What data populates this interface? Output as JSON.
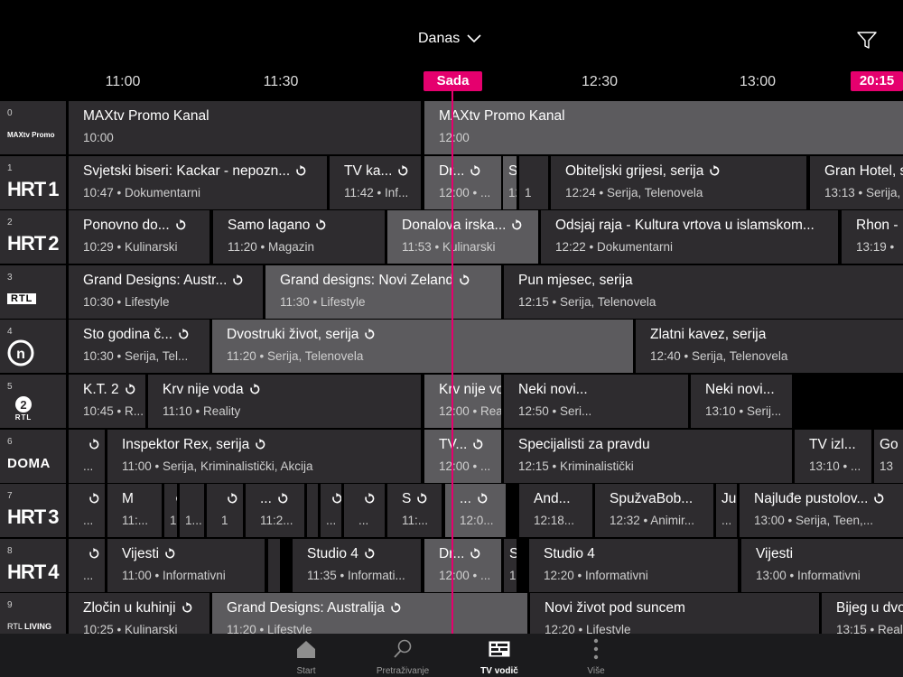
{
  "header": {
    "day": "Danas",
    "ticks": [
      "11:00",
      "11:30",
      "12:30",
      "13:00"
    ],
    "now_label": "Sada",
    "current_time": "20:15"
  },
  "channels": [
    {
      "num": "0",
      "logo": "MAXtv Promo",
      "programs": [
        {
          "title": "MAXtv Promo Kanal",
          "sub": "10:00"
        },
        {
          "title": "MAXtv Promo Kanal",
          "sub": "12:00"
        }
      ]
    },
    {
      "num": "1",
      "logo": "HRT 1",
      "programs": [
        {
          "title": "Svjetski biseri: Kackar - nepozn...",
          "sub": "10:47 • Dokumentarni"
        },
        {
          "title": "TV ka...",
          "sub": "11:42 • Inf..."
        },
        {
          "title": "Dr...",
          "sub": "12:00 • ..."
        },
        {
          "title": "S",
          "sub": "12"
        },
        {
          "title": "",
          "sub": "1"
        },
        {
          "title": "Obiteljski grijesi, serija",
          "sub": "12:24 • Serija, Telenovela"
        },
        {
          "title": "Gran Hotel, s",
          "sub": "13:13 • Serija,"
        }
      ]
    },
    {
      "num": "2",
      "logo": "HRT 2",
      "programs": [
        {
          "title": "Ponovno do...",
          "sub": "10:29 • Kulinarski"
        },
        {
          "title": "Samo lagano",
          "sub": "11:20 • Magazin"
        },
        {
          "title": "Donalova irska...",
          "sub": "11:53 • Kulinarski"
        },
        {
          "title": "Odsjaj raja - Kultura vrtova u islamskom...",
          "sub": "12:22 • Dokumentarni"
        },
        {
          "title": "Rhon -",
          "sub": "13:19 •"
        }
      ]
    },
    {
      "num": "3",
      "logo": "RTL",
      "programs": [
        {
          "title": "Grand Designs: Austr...",
          "sub": "10:30 • Lifestyle"
        },
        {
          "title": "Grand designs: Novi Zeland",
          "sub": "11:30 • Lifestyle"
        },
        {
          "title": "Pun mjesec, serija",
          "sub": "12:15 • Serija, Telenovela"
        }
      ]
    },
    {
      "num": "4",
      "logo": "Nova",
      "programs": [
        {
          "title": "Sto godina č...",
          "sub": "10:30 • Serija, Tel..."
        },
        {
          "title": "Dvostruki život, serija",
          "sub": "11:20 • Serija, Telenovela"
        },
        {
          "title": "Zlatni kavez, serija",
          "sub": "12:40 • Serija, Telenovela"
        }
      ]
    },
    {
      "num": "5",
      "logo": "RTL 2",
      "programs": [
        {
          "title": "K.T. 2",
          "sub": "10:45 • R..."
        },
        {
          "title": "Krv nije voda",
          "sub": "11:10 • Reality"
        },
        {
          "title": "Krv nije voda",
          "sub": "12:00 • Reality"
        },
        {
          "title": "Neki novi...",
          "sub": "12:50 • Seri..."
        },
        {
          "title": "Neki novi...",
          "sub": "13:10 • Serij..."
        }
      ]
    },
    {
      "num": "6",
      "logo": "DOMA",
      "programs": [
        {
          "title": "",
          "sub": "..."
        },
        {
          "title": "Inspektor Rex, serija",
          "sub": "11:00 • Serija, Kriminalistički, Akcija"
        },
        {
          "title": "TV...",
          "sub": "12:00 • ..."
        },
        {
          "title": "Specijalisti za pravdu",
          "sub": "12:15 • Kriminalistički"
        },
        {
          "title": "TV izl...",
          "sub": "13:10 • ..."
        },
        {
          "title": "Go",
          "sub": "13"
        }
      ]
    },
    {
      "num": "7",
      "logo": "HRT 3",
      "programs": [
        {
          "title": "",
          "sub": "..."
        },
        {
          "title": "M",
          "sub": "11:..."
        },
        {
          "title": "",
          "sub": "1"
        },
        {
          "title": "",
          "sub": "1..."
        },
        {
          "title": "",
          "sub": "1"
        },
        {
          "title": "...",
          "sub": "11:2..."
        },
        {
          "title": "",
          "sub": ""
        },
        {
          "title": "",
          "sub": "..."
        },
        {
          "title": "",
          "sub": "..."
        },
        {
          "title": "S",
          "sub": "11:..."
        },
        {
          "title": "...",
          "sub": "12:0..."
        },
        {
          "title": "And...",
          "sub": "12:18..."
        },
        {
          "title": "SpužvaBob...",
          "sub": "12:32 • Animir..."
        },
        {
          "title": "Ju",
          "sub": "..."
        },
        {
          "title": "Najluđe pustolov...",
          "sub": "13:00 • Serija, Teen,..."
        }
      ]
    },
    {
      "num": "8",
      "logo": "HRT 4",
      "programs": [
        {
          "title": "",
          "sub": "..."
        },
        {
          "title": "Vijesti",
          "sub": "11:00 • Informativni"
        },
        {
          "title": "",
          "sub": ""
        },
        {
          "title": "Studio 4",
          "sub": "11:35 • Informati..."
        },
        {
          "title": "Dr...",
          "sub": "12:00 • ..."
        },
        {
          "title": "S",
          "sub": "12"
        },
        {
          "title": "Studio 4",
          "sub": "12:20 • Informativni"
        },
        {
          "title": "Vijesti",
          "sub": "13:00 • Informativni"
        }
      ]
    },
    {
      "num": "9",
      "logo": "RTL LIVING",
      "programs": [
        {
          "title": "Zločin u kuhinji",
          "sub": "10:25 • Kulinarski"
        },
        {
          "title": "Grand Designs: Australija",
          "sub": "11:20 • Lifestyle"
        },
        {
          "title": "Novi život pod suncem",
          "sub": "12:20 • Lifestyle"
        },
        {
          "title": "Bijeg u dvo",
          "sub": "13:15 • Reali"
        }
      ]
    }
  ],
  "tabs": [
    {
      "label": "Start",
      "icon": "home-icon"
    },
    {
      "label": "Pretraživanje",
      "icon": "search-icon"
    },
    {
      "label": "TV vodič",
      "icon": "tv-guide-icon"
    },
    {
      "label": "Više",
      "icon": "more-icon"
    }
  ],
  "colors": {
    "accent": "#e5006e",
    "cell": "#2e2c2f",
    "live_cell": "#5c5b5e",
    "background": "#000000"
  }
}
